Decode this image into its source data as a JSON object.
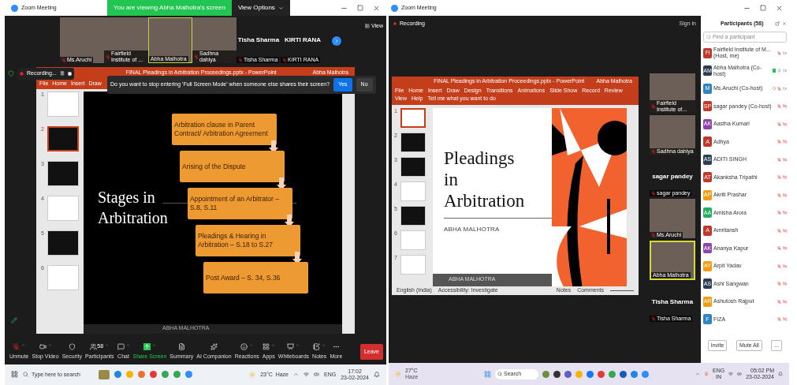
{
  "left_window": {
    "title": "Zoom Meeting",
    "banner": "You are viewing Abha Malhotra's screen",
    "view_options": "View Options",
    "gallery": [
      {
        "kind": "video",
        "name": "Ms.Aruchi",
        "muted": true,
        "active": false
      },
      {
        "kind": "video",
        "name": "Fairfield Institute of ...",
        "muted": true,
        "active": false
      },
      {
        "kind": "video",
        "name": "Abha Malhotra",
        "muted": false,
        "active": true
      },
      {
        "kind": "video",
        "name": "Sadhna dahiya",
        "muted": true,
        "active": false
      },
      {
        "kind": "name",
        "name": "Tisha Sharma",
        "display": "Tisha Sharma",
        "muted": true,
        "active": false
      },
      {
        "kind": "name",
        "name": "KIRTI RANA",
        "display": "KIRTI RANA",
        "muted": true,
        "active": false
      }
    ],
    "view_button": "View",
    "recording": "Recording...",
    "powerpoint": {
      "title": "FINAL Pleadings in Arbitration Proceedings.pptx - PowerPoint",
      "user": "Abha Malhotra",
      "ribbon": [
        "File",
        "Home",
        "Insert",
        "Draw"
      ],
      "thumbnails": [
        {
          "number": "1",
          "kind": "light",
          "selected": false
        },
        {
          "number": "2",
          "kind": "dark",
          "selected": true
        },
        {
          "number": "3",
          "kind": "dark",
          "selected": false
        },
        {
          "number": "4",
          "kind": "light",
          "selected": false
        },
        {
          "number": "5",
          "kind": "dark",
          "selected": false
        },
        {
          "number": "6",
          "kind": "light",
          "selected": false
        }
      ],
      "slide": {
        "title": "Stages in Arbitration",
        "steps": [
          "Arbitration clause in Parent Contract/ Arbitration Agreement",
          "Arising of the Dispute",
          "Appointment of an Arbitrator – S.8, S.11",
          "Pleadings & Hearing in Arbitration – S.18 to S.27",
          "Post Award – S. 34, S.36"
        ],
        "footer": "ABHA MALHOTRA"
      }
    },
    "dialog": {
      "message": "Do you want to stop entering 'Full Screen Mode' when someone else shares their screen?",
      "buttons": [
        {
          "label": "Yes",
          "primary": true
        },
        {
          "label": "No",
          "primary": false
        }
      ]
    },
    "toolbar": [
      {
        "kind": "mic_off",
        "label": "Unmute",
        "caret": true
      },
      {
        "kind": "video",
        "label": "Stop Video",
        "caret": true
      },
      {
        "kind": "security",
        "label": "Security",
        "caret": false
      },
      {
        "kind": "participants",
        "label": "Participants",
        "count": "58",
        "caret": true
      },
      {
        "kind": "chat",
        "label": "Chat",
        "caret": true
      },
      {
        "kind": "share",
        "label": "Share Screen",
        "caret": true
      },
      {
        "kind": "summary",
        "label": "Summary",
        "caret": false
      },
      {
        "kind": "ai",
        "label": "AI Companion",
        "caret": false
      },
      {
        "kind": "reactions",
        "label": "Reactions",
        "caret": true
      },
      {
        "kind": "apps",
        "label": "Apps",
        "caret": true
      },
      {
        "kind": "whiteboards",
        "label": "Whiteboards",
        "caret": true
      },
      {
        "kind": "notes",
        "label": "Notes",
        "caret": true
      },
      {
        "kind": "more",
        "label": "More",
        "caret": false
      }
    ],
    "leave": "Leave",
    "taskbar": {
      "search_placeholder": "Type here to search",
      "weather": "23°C  Haze",
      "language": "ENG",
      "time": "17:02",
      "date": "23-02-2024"
    }
  },
  "right_window": {
    "title": "Zoom Meeting",
    "recording": "Recording",
    "sign_in": "Sign in",
    "powerpoint": {
      "title": "FINAL Pleadings in Arbitration Proceedings.pptx - PowerPoint",
      "user": "Abha Malhotra",
      "ribbon": [
        "File",
        "Home",
        "Insert",
        "Draw",
        "Design",
        "Transitions",
        "Animations",
        "Slide Show",
        "Record",
        "Review",
        "View",
        "Help"
      ],
      "tell_me": "Tell me what you want to do",
      "thumbnails": [
        {
          "number": "1",
          "kind": "light",
          "selected": true
        },
        {
          "number": "2",
          "kind": "dark",
          "selected": false
        },
        {
          "number": "3",
          "kind": "dark",
          "selected": false
        },
        {
          "number": "4",
          "kind": "light",
          "selected": false
        },
        {
          "number": "5",
          "kind": "dark",
          "selected": false
        },
        {
          "number": "6",
          "kind": "light",
          "selected": false
        },
        {
          "number": "7",
          "kind": "light",
          "selected": false
        }
      ],
      "slide": {
        "title": "Pleadings in Arbitration",
        "author": "ABHA MALHOTRA",
        "footer": "ABHA MALHOTRA"
      },
      "status": [
        "English (India)",
        "Accessibility: Investigate"
      ],
      "status_right": [
        "Notes",
        "Comments"
      ]
    },
    "videos": [
      {
        "kind": "video",
        "name": "Fairfield Institute of...",
        "active": false
      },
      {
        "kind": "video",
        "name": "Sadhna dahiya",
        "active": false
      },
      {
        "kind": "name",
        "name": "sagar pandey",
        "display": "sagar pandey",
        "active": false
      },
      {
        "kind": "video",
        "name": "Ms.Aruchi",
        "active": false
      },
      {
        "kind": "video",
        "name": "Abha Malhotra",
        "active": true
      },
      {
        "kind": "name",
        "name": "Tisha Sharma",
        "display": "Tisha Sharma",
        "active": false
      }
    ],
    "participants": {
      "title": "Participants (58)",
      "search_placeholder": "Find a participant",
      "list": [
        {
          "initials": "FI",
          "color": "#c0392b",
          "name": "Fairfield Institute of M... (Host, me)",
          "mic_muted": true,
          "video_off": false,
          "sharing": false,
          "recording": false
        },
        {
          "initials": "AM",
          "color": "#2c3e50",
          "name": "Abha Malhotra (Co-host)",
          "mic_muted": false,
          "video_off": false,
          "sharing": true,
          "recording": false
        },
        {
          "initials": "M",
          "color": "#2e86c1",
          "name": "Ms.Aruchi (Co-host)",
          "mic_muted": true,
          "video_off": false,
          "sharing": false,
          "recording": true
        },
        {
          "initials": "SP",
          "color": "#c0392b",
          "name": "sagar pandey (Co-host)",
          "mic_muted": true,
          "video_off": true,
          "sharing": false,
          "recording": false
        },
        {
          "initials": "AK",
          "color": "#8e44ad",
          "name": "Aastha Kumari",
          "mic_muted": true,
          "video_off": true,
          "sharing": false,
          "recording": false
        },
        {
          "initials": "A",
          "color": "#c0392b",
          "name": "Adhya",
          "mic_muted": true,
          "video_off": true,
          "sharing": false,
          "recording": false
        },
        {
          "initials": "AS",
          "color": "#2c3e50",
          "name": "ADITI SINGH",
          "mic_muted": true,
          "video_off": true,
          "sharing": false,
          "recording": false
        },
        {
          "initials": "AT",
          "color": "#c0392b",
          "name": "Akanksha Tripathi",
          "mic_muted": true,
          "video_off": true,
          "sharing": false,
          "recording": false
        },
        {
          "initials": "AP",
          "color": "#f39c12",
          "name": "Akriti Prashar",
          "mic_muted": true,
          "video_off": true,
          "sharing": false,
          "recording": false
        },
        {
          "initials": "AA",
          "color": "#27ae60",
          "name": "Amisha Arora",
          "mic_muted": true,
          "video_off": true,
          "sharing": false,
          "recording": false
        },
        {
          "initials": "A",
          "color": "#c0392b",
          "name": "Amritansh",
          "mic_muted": true,
          "video_off": true,
          "sharing": false,
          "recording": false
        },
        {
          "initials": "AK",
          "color": "#8e44ad",
          "name": "Ananya Kapur",
          "mic_muted": true,
          "video_off": true,
          "sharing": false,
          "recording": false
        },
        {
          "initials": "AY",
          "color": "#f39c12",
          "name": "Arpit Yadav",
          "mic_muted": true,
          "video_off": true,
          "sharing": false,
          "recording": false
        },
        {
          "initials": "AS",
          "color": "#2c3e50",
          "name": "Ashi Sangwan",
          "mic_muted": true,
          "video_off": true,
          "sharing": false,
          "recording": false
        },
        {
          "initials": "AR",
          "color": "#f39c12",
          "name": "Ashutosh Rajput",
          "mic_muted": true,
          "video_off": true,
          "sharing": false,
          "recording": false
        },
        {
          "initials": "F",
          "color": "#2e86c1",
          "name": "FIZA",
          "mic_muted": true,
          "video_off": true,
          "sharing": false,
          "recording": false
        }
      ],
      "buttons": [
        "Invite",
        "Mute All",
        "..."
      ]
    },
    "taskbar": {
      "temperature": "27°C",
      "weather": "Haze",
      "search_placeholder": "Search",
      "language": "ENG",
      "region": "IN",
      "time": "05:02 PM",
      "date": "23-02-2024"
    }
  }
}
